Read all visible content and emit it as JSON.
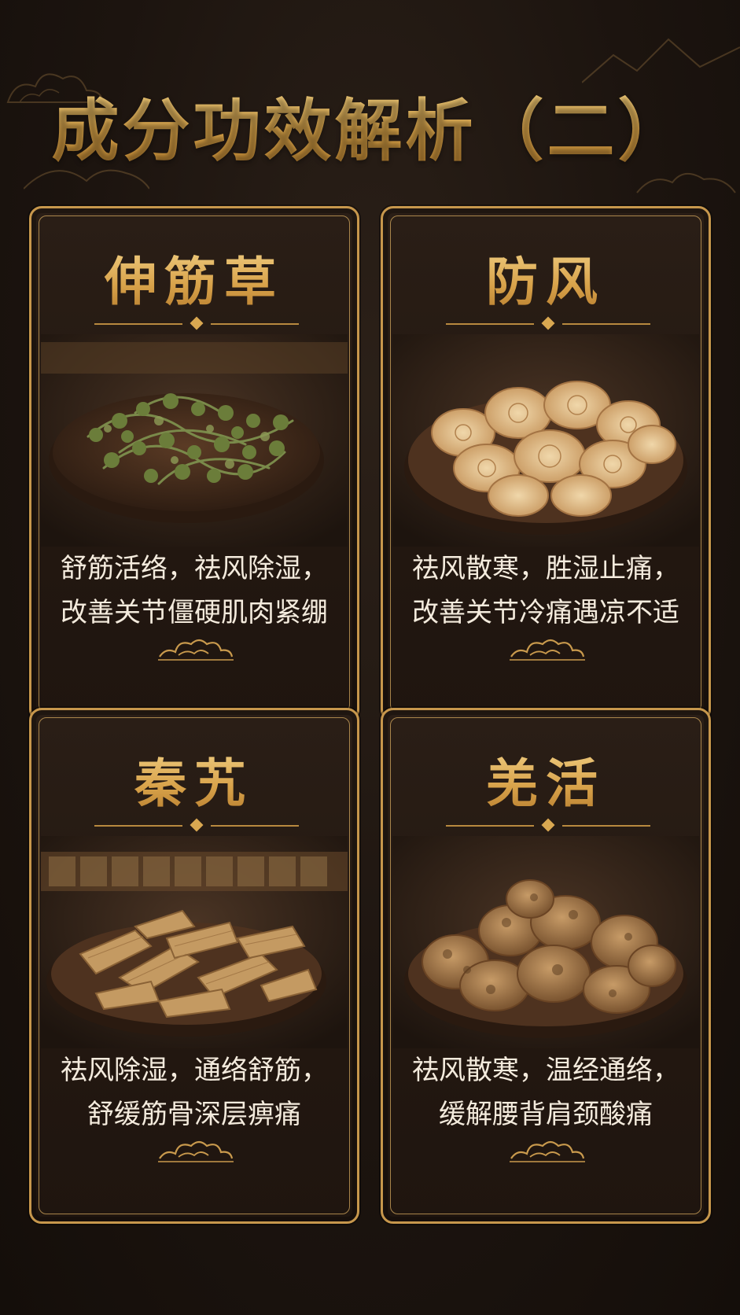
{
  "page": {
    "title": "成分功效解析（二）"
  },
  "cards": [
    {
      "name": "伸筋草",
      "line1": "舒筋活络，祛风除湿，",
      "line2": "改善关节僵硬肌肉紧绷",
      "herb_image": "dried-shenjincao-on-plate"
    },
    {
      "name": "防风",
      "line1": "祛风散寒，胜湿止痛，",
      "line2": "改善关节冷痛遇凉不适",
      "herb_image": "sliced-fangfeng-root-on-plate"
    },
    {
      "name": "秦艽",
      "line1": "祛风除湿，通络舒筋，",
      "line2": "舒缓筋骨深层痹痛",
      "herb_image": "sliced-qinjiao-root-on-plate"
    },
    {
      "name": "羌活",
      "line1": "祛风散寒，温经通络，",
      "line2": "缓解腰背肩颈酸痛",
      "herb_image": "dried-qianghuo-root-on-plate"
    }
  ],
  "colors": {
    "background": "#1c140f",
    "gold": "#d9a851",
    "text": "#f4ebdd"
  }
}
